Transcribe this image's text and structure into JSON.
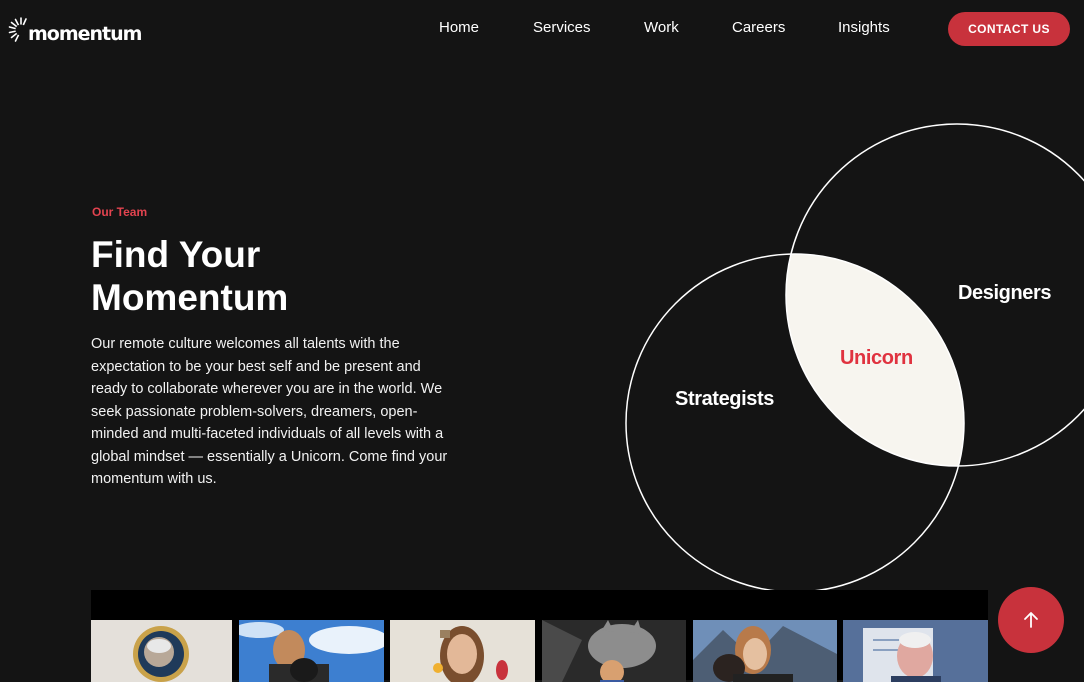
{
  "brand": {
    "name": "momentum",
    "accent_color": "#c8323c",
    "background_color": "#141414"
  },
  "nav": {
    "items": [
      {
        "label": "Home"
      },
      {
        "label": "Services"
      },
      {
        "label": "Work"
      },
      {
        "label": "Careers"
      },
      {
        "label": "Insights"
      }
    ],
    "cta_label": "CONTACT US"
  },
  "hero": {
    "eyebrow": "Our Team",
    "title_line1": "Find Your",
    "title_line2": "Momentum",
    "description": "Our remote culture welcomes all talents with the expectation to be your best self and be present and ready to collaborate wherever you are in the world. We seek passionate problem-solvers, dreamers, open-minded and multi-faceted individuals of all levels with a global mindset — essentially a Unicorn. Come find your momentum with us."
  },
  "venn": {
    "left_label": "Strategists",
    "right_label": "Designers",
    "overlap_label": "Unicorn",
    "overlap_color": "#f7f5ef",
    "overlap_text_color": "#e0323f"
  },
  "team_photos": [
    {
      "icon": "team-photo-1"
    },
    {
      "icon": "team-photo-2"
    },
    {
      "icon": "team-photo-3"
    },
    {
      "icon": "team-photo-4"
    },
    {
      "icon": "team-photo-5"
    },
    {
      "icon": "team-photo-6"
    }
  ],
  "scroll_top": {
    "icon": "arrow-up-icon"
  }
}
